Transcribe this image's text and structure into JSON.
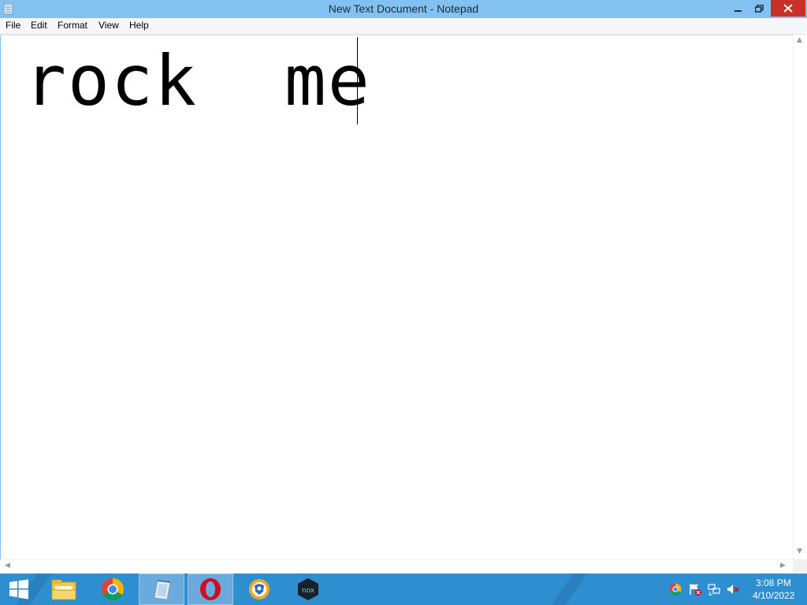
{
  "window": {
    "title": "New Text Document - Notepad",
    "accent_color": "#82c1f0",
    "close_color": "#c7312a"
  },
  "menu": {
    "items": [
      "File",
      "Edit",
      "Format",
      "View",
      "Help"
    ]
  },
  "editor": {
    "content": "rock  me "
  },
  "taskbar": {
    "color": "#2d8fd0",
    "apps": [
      {
        "icon": "windows-start-icon"
      },
      {
        "icon": "file-explorer-icon"
      },
      {
        "icon": "chrome-icon"
      },
      {
        "icon": "notepad-icon",
        "active": true
      },
      {
        "icon": "opera-icon",
        "active": true
      },
      {
        "icon": "vpn-shield-icon"
      },
      {
        "icon": "nox-player-icon"
      }
    ],
    "tray_icons": [
      "chrome-tray-icon",
      "action-center-flag-icon",
      "network-icon",
      "volume-muted-icon"
    ],
    "clock": {
      "time": "3:08 PM",
      "date": "4/10/2022"
    }
  }
}
